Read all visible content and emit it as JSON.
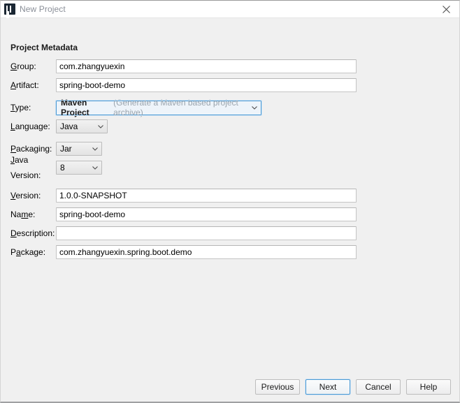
{
  "window": {
    "title": "New Project",
    "icon": "intellij-idea-icon",
    "close_icon": "close-icon"
  },
  "section": {
    "heading": "Project Metadata"
  },
  "fields": {
    "group": {
      "label": "Group:",
      "mnemonic": "G",
      "value": "com.zhangyuexin"
    },
    "artifact": {
      "label": "Artifact:",
      "mnemonic": "A",
      "value": "spring-boot-demo"
    },
    "type": {
      "label": "Type:",
      "mnemonic": "T",
      "value": "Maven Project",
      "description": "(Generate a Maven based project archive)"
    },
    "language": {
      "label": "Language:",
      "mnemonic": "L",
      "value": "Java"
    },
    "packaging": {
      "label": "Packaging:",
      "mnemonic": "P",
      "value": "Jar"
    },
    "java_version": {
      "label": "Java Version:",
      "mnemonic": "J",
      "value": "8"
    },
    "version": {
      "label": "Version:",
      "mnemonic": "V",
      "value": "1.0.0-SNAPSHOT"
    },
    "name": {
      "label": "Name:",
      "mnemonic": "m",
      "value": "spring-boot-demo"
    },
    "description": {
      "label": "Description:",
      "mnemonic": "D",
      "value": "",
      "placeholder": ""
    },
    "package": {
      "label": "Package:",
      "mnemonic": "a",
      "value": "com.zhangyuexin.spring.boot.demo"
    }
  },
  "footer": {
    "previous": "Previous",
    "next": "Next",
    "cancel": "Cancel",
    "help": "Help"
  },
  "colors": {
    "focus_blue": "#4b9ad4",
    "window_bg": "#f0f0f0",
    "field_bg": "#ffffff",
    "title_text": "#8a8f98",
    "hint_text": "#9aa4ad"
  }
}
